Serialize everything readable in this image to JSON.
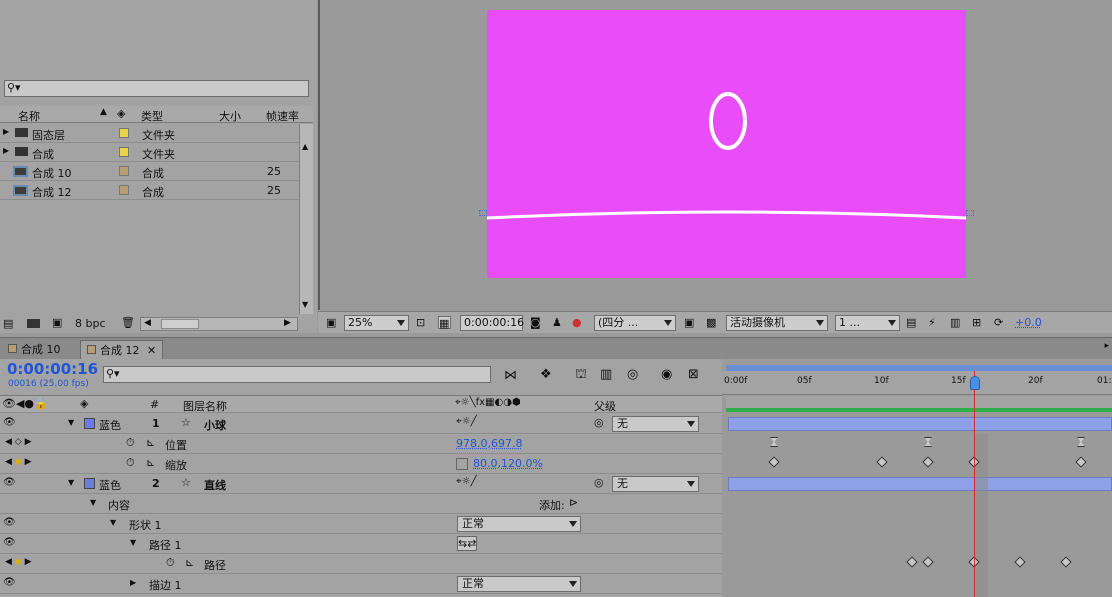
{
  "project": {
    "search_placeholder": "",
    "columns": {
      "name": "名称",
      "type": "类型",
      "size": "大小",
      "fps": "帧速率"
    },
    "items": [
      {
        "name": "固态层",
        "type": "文件夹",
        "fps": "",
        "kind": "folder",
        "color": "#e8d44a"
      },
      {
        "name": "合成",
        "type": "文件夹",
        "fps": "",
        "kind": "folder",
        "color": "#e8d44a"
      },
      {
        "name": "合成 10",
        "type": "合成",
        "fps": "25",
        "kind": "comp",
        "color": "#b89e74"
      },
      {
        "name": "合成 12",
        "type": "合成",
        "fps": "25",
        "kind": "comp",
        "color": "#b89e74"
      }
    ],
    "bpc_label": "8 bpc"
  },
  "viewer": {
    "canvas_color": "#e84df8",
    "zoom": "25%",
    "timecode": "0:00:00:16",
    "resolution": "(四分 ...",
    "camera": "活动摄像机",
    "views": "1 ...",
    "exposure": "+0.0"
  },
  "tabs": [
    {
      "label": "合成 10",
      "active": false
    },
    {
      "label": "合成 12",
      "active": true
    }
  ],
  "timeline": {
    "current_time": "0:00:00:16",
    "frame_info": "00016 (25.00 fps)",
    "search_placeholder": "",
    "header": {
      "num": "#",
      "layer_name": "图层名称",
      "parent": "父级"
    },
    "ruler": [
      "0:00f",
      "05f",
      "10f",
      "15f",
      "20f",
      "01:"
    ],
    "layers": [
      {
        "label": "蓝色",
        "num": "1",
        "name": "小球",
        "parent": "无",
        "label_color": "#6b7be0"
      },
      {
        "label": "蓝色",
        "num": "2",
        "name": "直线",
        "parent": "无",
        "label_color": "#6b7be0"
      }
    ],
    "props": {
      "position": {
        "name": "位置",
        "value": "978.0,697.8"
      },
      "scale": {
        "name": "缩放",
        "value": "80.0,120.0%"
      },
      "contents": "内容",
      "add_label": "添加:",
      "shape": "形状 1",
      "shape_mode": "正常",
      "path_group": "路径 1",
      "path": "路径",
      "stroke": "描边 1",
      "stroke_mode": "正常"
    }
  }
}
